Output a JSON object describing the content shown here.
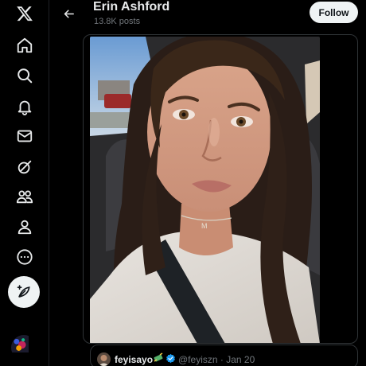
{
  "profile": {
    "name": "Erin Ashford",
    "posts_count": "13.8K posts",
    "follow_label": "Follow"
  },
  "nav": {
    "items": [
      {
        "icon": "x-logo-icon"
      },
      {
        "icon": "home-icon"
      },
      {
        "icon": "search-icon"
      },
      {
        "icon": "bell-icon"
      },
      {
        "icon": "mail-icon"
      },
      {
        "icon": "grok-icon"
      },
      {
        "icon": "communities-icon"
      },
      {
        "icon": "profile-icon"
      },
      {
        "icon": "more-icon"
      }
    ],
    "compose_icon": "compose-post-icon"
  },
  "quote": {
    "name": "feyisayo",
    "handle": "@feyiszn",
    "date": "Jan 20",
    "separator": "·"
  },
  "colors": {
    "background": "#000000",
    "text_primary": "#e7e9ea",
    "text_secondary": "#71767b",
    "border": "#2f3336",
    "button_bg": "#eff3f4",
    "verified": "#1d9bf0"
  }
}
